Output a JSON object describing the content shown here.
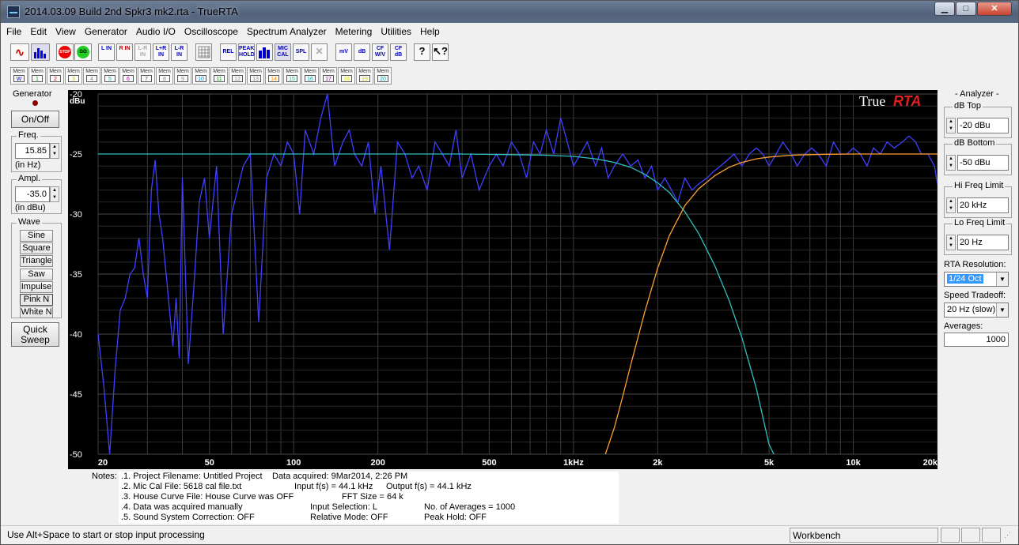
{
  "window": {
    "title": "2014.03.09 Build 2nd Spkr3 mk2.rta - TrueRTA",
    "min_label": "▁",
    "max_label": "□",
    "close_label": "✕"
  },
  "menu": [
    "File",
    "Edit",
    "View",
    "Generator",
    "Audio I/O",
    "Oscilloscope",
    "Spectrum Analyzer",
    "Metering",
    "Utilities",
    "Help"
  ],
  "toolbar": {
    "buttons": [
      "L IN",
      "R IN",
      "L-R IN",
      "L+R IN",
      "L-R IN",
      "REL",
      "PEAK HOLD",
      "MIC CAL",
      "SPL",
      "mV",
      "dB",
      "CF W/V",
      "CF dB"
    ],
    "stop_label": "STOP",
    "go_label": "GO"
  },
  "memory": {
    "labels": [
      "Mem",
      "Mem",
      "Mem",
      "Mem",
      "Mem",
      "Mem",
      "Mem",
      "Mem",
      "Mem",
      "Mem",
      "Mem",
      "Mem",
      "Mem",
      "Mem",
      "Mem",
      "Mem",
      "Mem",
      "Mem",
      "Mem",
      "Mem",
      "Mem"
    ],
    "numbers": [
      "W",
      "1",
      "2",
      "3",
      "4",
      "5",
      "6",
      "7",
      "8",
      "9",
      "10",
      "11",
      "12",
      "13",
      "14",
      "15",
      "16",
      "17",
      "18",
      "19",
      "20"
    ],
    "colors": [
      "#00c",
      "#0a0",
      "#c00",
      "#cc0",
      "#888",
      "#0aa",
      "#a0a",
      "#555",
      "#888",
      "#888",
      "#08c",
      "#0a0",
      "#888",
      "#888",
      "#f80",
      "#0c8",
      "#0aa",
      "#a0c",
      "#dd0",
      "#cc0",
      "#0aa"
    ]
  },
  "generator": {
    "title": "Generator",
    "on_off": "On/Off",
    "freq_label": "Freq.",
    "freq_value": "15.85",
    "freq_unit": "(in Hz)",
    "ampl_label": "Ampl.",
    "ampl_value": "-35.0",
    "ampl_unit": "(in dBu)",
    "wave_label": "Wave",
    "waves": [
      "Sine",
      "Square",
      "Triangle",
      "Saw",
      "Impulse",
      "Pink N",
      "White N"
    ],
    "quick_sweep_1": "Quick",
    "quick_sweep_2": "Sweep"
  },
  "analyzer": {
    "title": "Analyzer",
    "db_top_label": "dB Top",
    "db_top": "-20 dBu",
    "db_bottom_label": "dB Bottom",
    "db_bottom": "-50 dBu",
    "hi_freq_label": "Hi Freq Limit",
    "hi_freq": "20 kHz",
    "lo_freq_label": "Lo Freq Limit",
    "lo_freq": "20 Hz",
    "rta_res_label": "RTA Resolution:",
    "rta_res": "1/24 Oct",
    "speed_label": "Speed Tradeoff:",
    "speed": "20 Hz (slow)",
    "averages_label": "Averages:",
    "averages": "1000"
  },
  "chart_data": {
    "type": "line",
    "logo_a": "True",
    "logo_b": "RTA",
    "ylabel": "dBu",
    "xscale": "log",
    "xlim": [
      20,
      20000
    ],
    "ylim": [
      -50,
      -20
    ],
    "yticks": [
      "-20",
      "-25",
      "-30",
      "-35",
      "-40",
      "-45",
      "-50"
    ],
    "xticks": [
      "20",
      "50",
      "100",
      "200",
      "500",
      "1kHz",
      "2k",
      "5k",
      "10k",
      "20k"
    ],
    "xtick_values": [
      20,
      50,
      100,
      200,
      500,
      1000,
      2000,
      5000,
      10000,
      20000
    ],
    "ytick_values": [
      -20,
      -25,
      -30,
      -35,
      -40,
      -45,
      -50
    ],
    "grid": true,
    "series": [
      {
        "color": "#4040ff",
        "x": [
          20,
          21,
          22,
          23,
          24,
          25,
          26,
          27,
          28,
          29,
          30,
          31,
          32,
          33,
          34,
          35,
          36,
          37,
          38,
          39,
          40,
          42,
          44,
          46,
          48,
          50,
          53,
          56,
          60,
          63,
          66,
          70,
          75,
          80,
          85,
          90,
          95,
          100,
          105,
          110,
          118,
          125,
          132,
          140,
          150,
          158,
          165,
          175,
          185,
          195,
          205,
          220,
          235,
          250,
          265,
          280,
          300,
          320,
          340,
          360,
          380,
          400,
          430,
          460,
          500,
          530,
          560,
          600,
          640,
          680,
          720,
          760,
          800,
          850,
          900,
          950,
          1000,
          1060,
          1120,
          1200,
          1260,
          1330,
          1400,
          1500,
          1600,
          1700,
          1800,
          1900,
          2000,
          2120,
          2240,
          2360,
          2500,
          2650,
          2800,
          3000,
          3150,
          3350,
          3550,
          3750,
          4000,
          4250,
          4500,
          4750,
          5000,
          5300,
          5600,
          6000,
          6300,
          6700,
          7100,
          7500,
          8000,
          8500,
          9000,
          9500,
          10000,
          10600,
          11200,
          11800,
          12500,
          13200,
          14000,
          15000,
          15800,
          16700,
          17500,
          18500,
          19500,
          20000
        ],
        "y": [
          -40,
          -44.5,
          -50,
          -43,
          -38,
          -37,
          -35,
          -34.5,
          -32,
          -35,
          -37,
          -28,
          -25.5,
          -30,
          -32,
          -35,
          -38,
          -41,
          -37,
          -42,
          -27,
          -42.5,
          -36,
          -29,
          -27,
          -32,
          -26,
          -40,
          -30,
          -28,
          -26,
          -25,
          -39,
          -27,
          -25,
          -26,
          -24,
          -25,
          -30,
          -23,
          -25,
          -22,
          -20,
          -26,
          -24,
          -23,
          -25,
          -26,
          -24,
          -30,
          -26,
          -33,
          -24,
          -25,
          -27,
          -26,
          -28,
          -24,
          -25,
          -26,
          -23,
          -27,
          -25,
          -28,
          -26,
          -25,
          -26,
          -24,
          -25,
          -27,
          -24,
          -25,
          -23,
          -25,
          -22,
          -24,
          -26,
          -25,
          -24,
          -26,
          -24.5,
          -27,
          -26,
          -25,
          -26,
          -25.5,
          -27,
          -26,
          -28,
          -27,
          -28,
          -29,
          -27,
          -28,
          -27.5,
          -27,
          -26.5,
          -26,
          -25.5,
          -25,
          -26,
          -25,
          -24.5,
          -25,
          -26,
          -25,
          -24,
          -25,
          -26,
          -25,
          -24.5,
          -25,
          -26,
          -24,
          -25,
          -25,
          -24.5,
          -25,
          -26,
          -24.5,
          -25,
          -24,
          -24.5,
          -24,
          -23.5,
          -24,
          -25,
          -25,
          -26,
          -27.5
        ]
      },
      {
        "color": "#30c0c0",
        "x": [
          20,
          50,
          100,
          200,
          400,
          600,
          800,
          1000,
          1200,
          1400,
          1600,
          1800,
          2000,
          2200,
          2500,
          2800,
          3200,
          3600,
          4000,
          4500,
          5000,
          5200
        ],
        "y": [
          -25,
          -25,
          -25,
          -25,
          -25,
          -25.05,
          -25.1,
          -25.2,
          -25.4,
          -25.7,
          -26.1,
          -26.7,
          -27.4,
          -28.2,
          -29.8,
          -31.6,
          -34.3,
          -37.2,
          -40.3,
          -44.5,
          -49.2,
          -50
        ]
      },
      {
        "color": "#ffa030",
        "x": [
          1300,
          1400,
          1500,
          1600,
          1800,
          2000,
          2200,
          2500,
          2800,
          3200,
          3600,
          4000,
          4500,
          5000,
          6000,
          7000,
          8000,
          10000,
          12000,
          15000,
          20000
        ],
        "y": [
          -50,
          -47.8,
          -45.2,
          -42.6,
          -38.1,
          -34.5,
          -31.8,
          -29.3,
          -27.9,
          -26.8,
          -26.1,
          -25.7,
          -25.4,
          -25.25,
          -25.1,
          -25.05,
          -25.02,
          -25,
          -25,
          -25,
          -25
        ]
      }
    ]
  },
  "notes": {
    "label": "Notes:",
    "l1a": ".1. Project Filename: Untitled Project",
    "l1b": "Data acquired: 9Mar2014, 2:26 PM",
    "l2a": ".2. Mic Cal File: 5618 cal file.txt",
    "l2b": "Input f(s) = 44.1 kHz",
    "l2c": "Output f(s) = 44.1 kHz",
    "l3a": ".3. House Curve File: House Curve was OFF",
    "l3b": "FFT Size = 64 k",
    "l4a": ".4. Data was acquired manually",
    "l4b": "Input Selection: L",
    "l4c": "No. of Averages = 1000",
    "l5a": ".5. Sound System Correction: OFF",
    "l5b": "Relative Mode:  OFF",
    "l5c": "Peak Hold: OFF"
  },
  "status": {
    "hint": "Use Alt+Space to start or stop input processing",
    "profile": "Workbench"
  }
}
